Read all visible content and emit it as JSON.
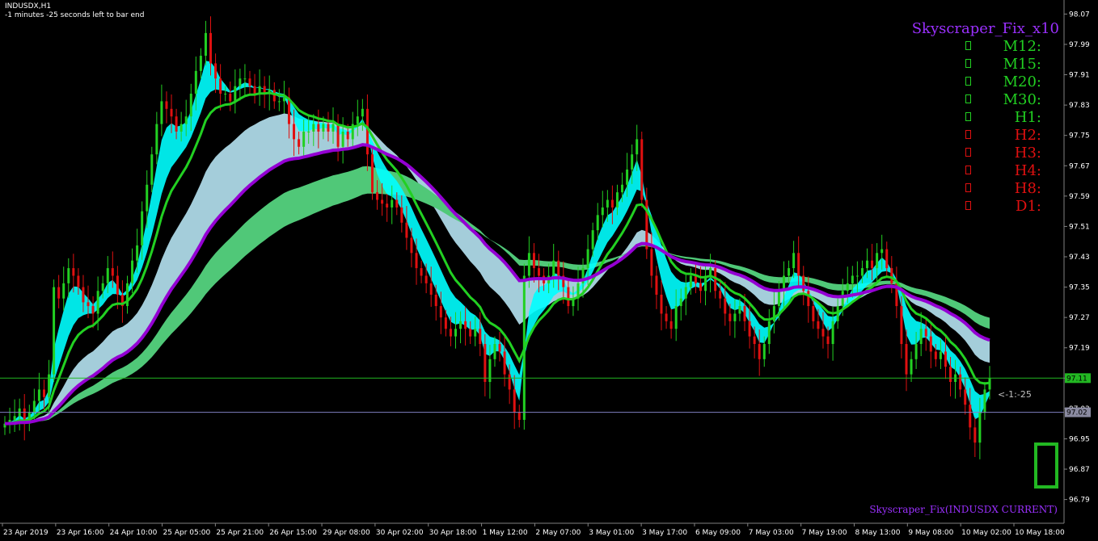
{
  "header": {
    "symbol": "INDUSDX,H1",
    "timer": "-1 minutes -25 seconds left to bar end"
  },
  "panel": {
    "title": "Skyscraper_Fix_x10",
    "timeframes": [
      {
        "label": "M12:",
        "state": "up",
        "color": "#22d022"
      },
      {
        "label": "M15:",
        "state": "up",
        "color": "#22d022"
      },
      {
        "label": "M20:",
        "state": "up",
        "color": "#22d022"
      },
      {
        "label": "M30:",
        "state": "up",
        "color": "#22d022"
      },
      {
        "label": "H1:",
        "state": "up",
        "color": "#22d022"
      },
      {
        "label": "H2:",
        "state": "down",
        "color": "#e01010"
      },
      {
        "label": "H3:",
        "state": "down",
        "color": "#e01010"
      },
      {
        "label": "H4:",
        "state": "down",
        "color": "#e01010"
      },
      {
        "label": "H8:",
        "state": "down",
        "color": "#e01010"
      },
      {
        "label": "D1:",
        "state": "down",
        "color": "#e01010"
      }
    ]
  },
  "indicator_label": "Skyscraper_Fix(INDUSDX CURRENT)",
  "countdown_label": "<-1:-25",
  "colors": {
    "background": "#000000",
    "bull": "#22d022",
    "bear": "#e01010",
    "cyan_band": "#00ffff",
    "lightblue_band": "#add8e6",
    "green_band": "#50c878",
    "orange_band": "#ffa500",
    "purple_line": "#9400d3",
    "salmon_band": "#fa8072"
  },
  "chart_data": {
    "type": "candlestick",
    "y_ticks": [
      "98.07",
      "97.99",
      "97.91",
      "97.83",
      "97.75",
      "97.67",
      "97.59",
      "97.51",
      "97.43",
      "97.35",
      "97.27",
      "97.19",
      "97.11",
      "97.03",
      "96.95",
      "96.87",
      "96.79"
    ],
    "ylim": [
      96.77,
      98.09
    ],
    "x_ticks": [
      "23 Apr 2019",
      "23 Apr 16:00",
      "24 Apr 10:00",
      "25 Apr 05:00",
      "25 Apr 21:00",
      "26 Apr 15:00",
      "29 Apr 08:00",
      "30 Apr 02:00",
      "30 Apr 18:00",
      "1 May 12:00",
      "2 May 07:00",
      "3 May 01:00",
      "3 May 17:00",
      "6 May 09:00",
      "7 May 03:00",
      "7 May 19:00",
      "8 May 13:00",
      "9 May 08:00",
      "10 May 02:00",
      "10 May 18:00"
    ],
    "bid_price": "97.11",
    "ask_price": "97.02",
    "bid_value": 97.11,
    "ask_value": 97.02,
    "closes": [
      96.99,
      97.0,
      97.01,
      97.03,
      96.99,
      97.02,
      97.05,
      97.08,
      97.06,
      97.12,
      97.35,
      97.32,
      97.36,
      97.4,
      97.38,
      97.35,
      97.31,
      97.3,
      97.28,
      97.34,
      97.36,
      97.4,
      97.38,
      97.33,
      97.3,
      97.36,
      97.42,
      97.46,
      97.55,
      97.62,
      97.7,
      97.78,
      97.84,
      97.82,
      97.8,
      97.76,
      97.78,
      97.8,
      97.86,
      97.92,
      97.96,
      98.02,
      97.94,
      97.9,
      97.86,
      97.86,
      97.84,
      97.88,
      97.9,
      97.9,
      97.88,
      97.86,
      97.88,
      97.86,
      97.87,
      97.84,
      97.84,
      97.85,
      97.78,
      97.74,
      97.72,
      97.76,
      97.76,
      97.78,
      97.76,
      97.78,
      97.76,
      97.78,
      97.72,
      97.76,
      97.74,
      97.78,
      97.8,
      97.82,
      97.7,
      97.6,
      97.58,
      97.57,
      97.56,
      97.58,
      97.56,
      97.52,
      97.48,
      97.44,
      97.4,
      97.38,
      97.36,
      97.33,
      97.3,
      97.27,
      97.24,
      97.22,
      97.24,
      97.26,
      97.24,
      97.22,
      97.24,
      97.2,
      97.1,
      97.16,
      97.2,
      97.18,
      97.12,
      97.08,
      97.02,
      97.0,
      97.38,
      97.44,
      97.4,
      97.38,
      97.36,
      97.38,
      97.42,
      97.38,
      97.35,
      97.3,
      97.32,
      97.36,
      97.4,
      97.45,
      97.5,
      97.54,
      97.56,
      97.58,
      97.56,
      97.6,
      97.62,
      97.66,
      97.7,
      97.74,
      97.58,
      97.45,
      97.38,
      97.33,
      97.28,
      97.26,
      97.24,
      97.3,
      97.32,
      97.35,
      97.38,
      97.36,
      97.34,
      97.38,
      97.4,
      97.34,
      97.32,
      97.28,
      97.26,
      97.28,
      97.3,
      97.26,
      97.22,
      97.2,
      97.16,
      97.2,
      97.26,
      97.3,
      97.34,
      97.38,
      97.4,
      97.44,
      97.38,
      97.34,
      97.3,
      97.26,
      97.24,
      97.22,
      97.2,
      97.26,
      97.3,
      97.34,
      97.36,
      97.38,
      97.38,
      97.4,
      97.42,
      97.4,
      97.44,
      97.45,
      97.4,
      97.36,
      97.3,
      97.2,
      97.12,
      97.16,
      97.2,
      97.24,
      97.22,
      97.18,
      97.16,
      97.18,
      97.14,
      97.1,
      97.12,
      97.08,
      97.04,
      96.98,
      96.94,
      97.02,
      97.08,
      97.11
    ],
    "bands": {
      "cyan": {
        "upper_value": 97.9,
        "lower_value": 97.5
      },
      "light_blue": {
        "upper_value": 97.6,
        "lower_value": 96.85
      },
      "green": {
        "upper_value": 97.38,
        "lower_value": 96.8
      }
    }
  }
}
